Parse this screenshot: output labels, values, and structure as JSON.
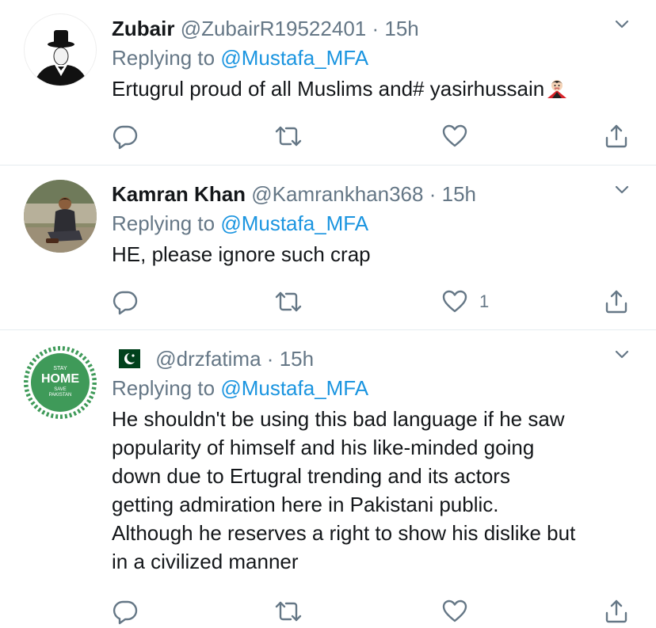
{
  "tweets": [
    {
      "author_name": "Zubair",
      "handle": "@ZubairR19522401",
      "dot": "·",
      "time": "15h",
      "replying_prefix": "Replying to",
      "replying_to": "@Mustafa_MFA",
      "text": "Ertugrul proud of all Muslims and# yasirhussain",
      "text_emoji_icon": "vampire-icon",
      "like_count": ""
    },
    {
      "author_name": "Kamran Khan",
      "handle": "@Kamrankhan368",
      "dot": "·",
      "time": "15h",
      "replying_prefix": "Replying to",
      "replying_to": "@Mustafa_MFA",
      "text": "HE, please ignore such crap",
      "like_count": "1"
    },
    {
      "author_name": "",
      "name_flag_icon": "pakistan-flag-icon",
      "handle": "@drzfatima",
      "dot": "·",
      "time": "15h",
      "replying_prefix": "Replying to",
      "replying_to": "@Mustafa_MFA",
      "text_lines": [
        "He shouldn't be using this bad language if he saw",
        "popularity of himself and his like-minded going",
        "down due to Ertugral trending and its actors",
        "getting admiration here in Pakistani public.",
        "Although he reserves a right to show his dislike but",
        "in a civilized manner"
      ],
      "avatar_text": {
        "top": "STAY",
        "middle": "HOME",
        "save": "SAVE",
        "country": "PAKISTAN"
      },
      "like_count": ""
    }
  ],
  "colors": {
    "text": "#14171a",
    "secondary": "#657786",
    "link": "#1b95e0",
    "divider": "#e6ecf0",
    "avatar3_green": "#3f9a59"
  }
}
